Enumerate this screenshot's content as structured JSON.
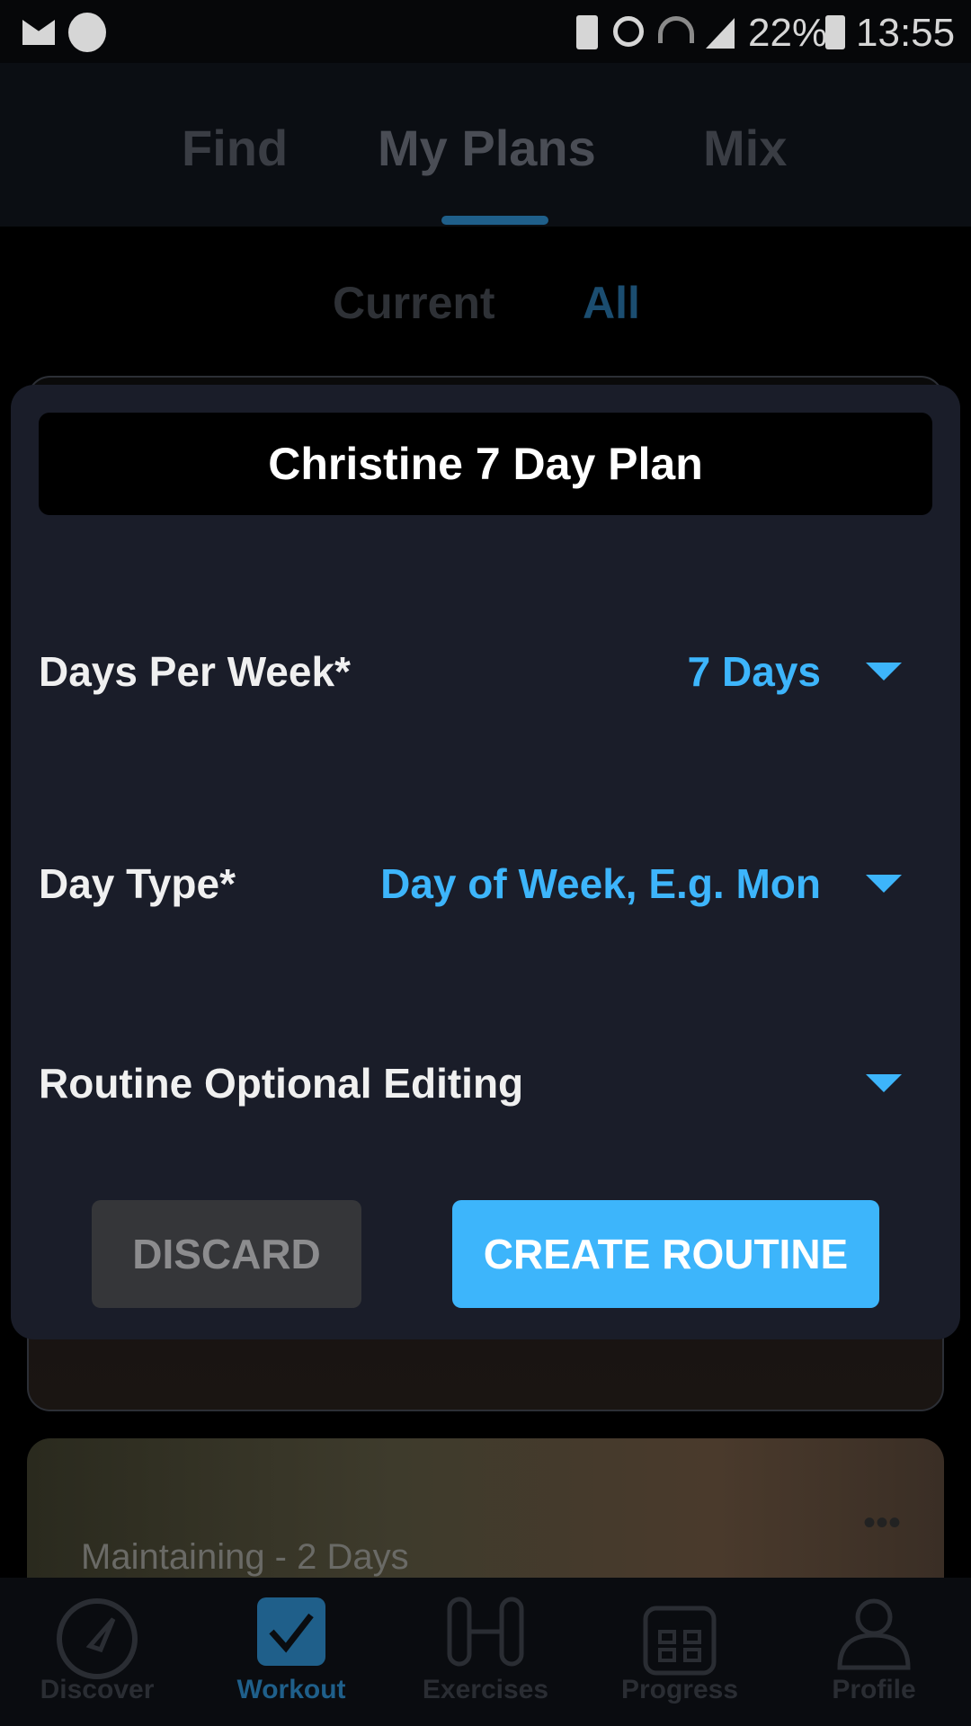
{
  "status_bar": {
    "battery_percent": "22%",
    "time": "13:55",
    "left_icons": [
      "mail-icon",
      "power-saving-icon"
    ],
    "right_icons": [
      "battery-saver-icon",
      "alarm-icon",
      "wifi-icon",
      "signal-icon",
      "battery-charging-icon"
    ]
  },
  "top_tabs": [
    {
      "label": "Find"
    },
    {
      "label": "My Plans",
      "active": true
    },
    {
      "label": "Mix"
    }
  ],
  "sub_tabs": [
    {
      "label": "Current"
    },
    {
      "label": "All",
      "active": true
    }
  ],
  "background_cards": [
    {
      "label": "Maintaining - 2 Days"
    }
  ],
  "dialog": {
    "title": "Christine 7 Day Plan",
    "fields": [
      {
        "label": "Days Per Week*",
        "value": "7 Days"
      },
      {
        "label": "Day Type*",
        "value": "Day of Week, E.g. Mon"
      },
      {
        "label": "Routine Optional Editing",
        "value": ""
      }
    ],
    "discard_label": "DISCARD",
    "create_label": "CREATE ROUTINE"
  },
  "bottom_nav": [
    {
      "label": "Discover"
    },
    {
      "label": "Workout",
      "active": true
    },
    {
      "label": "Exercises"
    },
    {
      "label": "Progress"
    },
    {
      "label": "Profile"
    }
  ],
  "colors": {
    "accent": "#3db5fb",
    "dialog_bg": "#1a1d29",
    "nav_active": "#1f5f8a"
  }
}
